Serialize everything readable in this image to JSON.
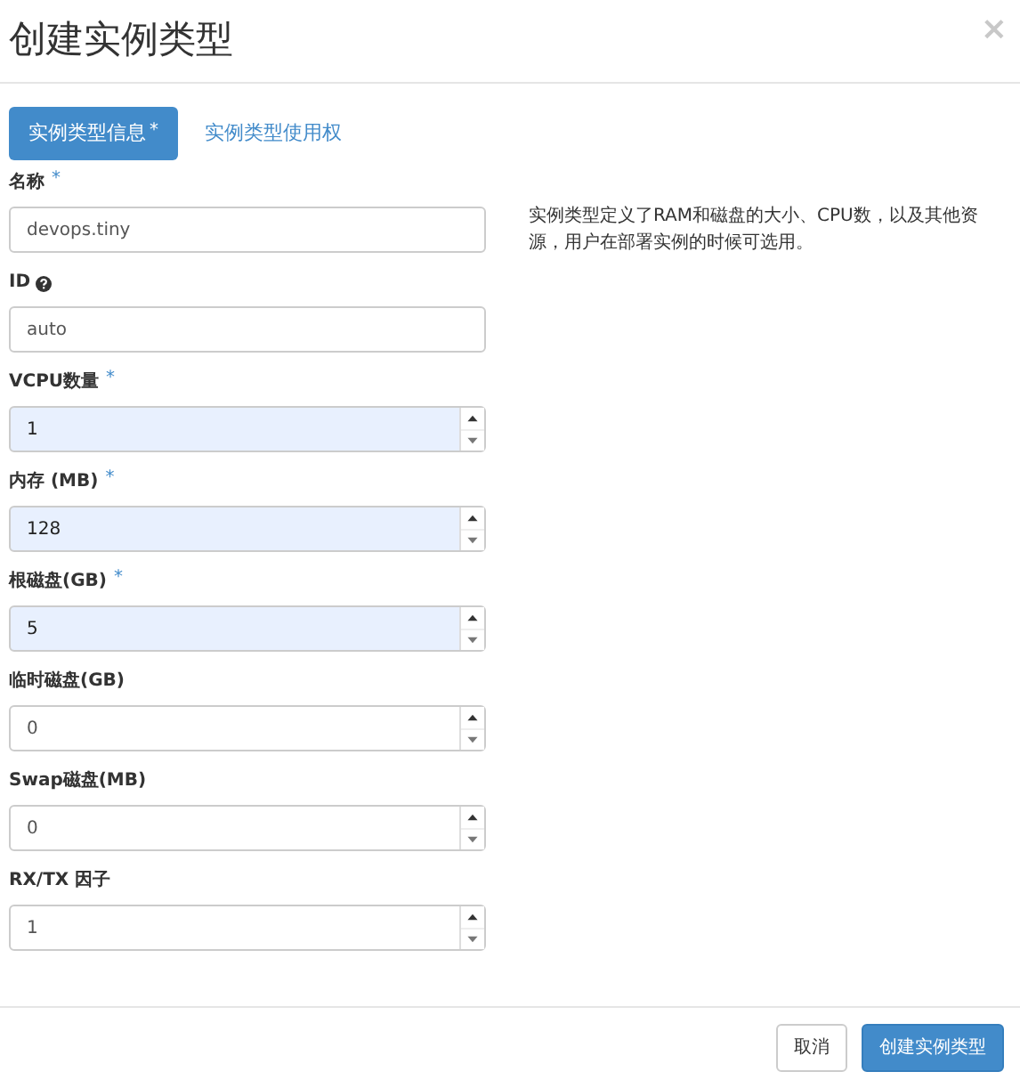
{
  "dialog": {
    "title": "创建实例类型",
    "close": "×"
  },
  "tabs": [
    {
      "label": "实例类型信息",
      "asterisk": "*",
      "selected": true
    },
    {
      "label": "实例类型使用权",
      "selected": false
    }
  ],
  "fields": [
    {
      "kind": "text",
      "label": "名称",
      "asterisk": "*",
      "help": false,
      "value": "devops.tiny",
      "autofilled": false
    },
    {
      "kind": "text",
      "label": "ID",
      "help": true,
      "value": "auto",
      "autofilled": false
    },
    {
      "kind": "number",
      "label": "VCPU数量",
      "asterisk": "*",
      "help": false,
      "value": "1",
      "autofilled": true
    },
    {
      "kind": "number",
      "label": "内存 (MB)",
      "asterisk": "*",
      "help": false,
      "value": "128",
      "autofilled": true
    },
    {
      "kind": "number",
      "label": "根磁盘(GB)",
      "asterisk": "*",
      "help": false,
      "value": "5",
      "autofilled": true
    },
    {
      "kind": "number",
      "label": "临时磁盘(GB)",
      "help": false,
      "value": "0",
      "autofilled": false
    },
    {
      "kind": "number",
      "label": "Swap磁盘(MB)",
      "help": false,
      "value": "0",
      "autofilled": false
    },
    {
      "kind": "number",
      "label": "RX/TX 因子",
      "help": false,
      "value": "1",
      "autofilled": false
    }
  ],
  "description": "实例类型定义了RAM和磁盘的大小、CPU数，以及其他资源，用户在部署实例的时候可选用。",
  "buttons": [
    {
      "label": "取消",
      "kind": "default"
    },
    {
      "label": "创建实例类型",
      "kind": "primary"
    }
  ]
}
